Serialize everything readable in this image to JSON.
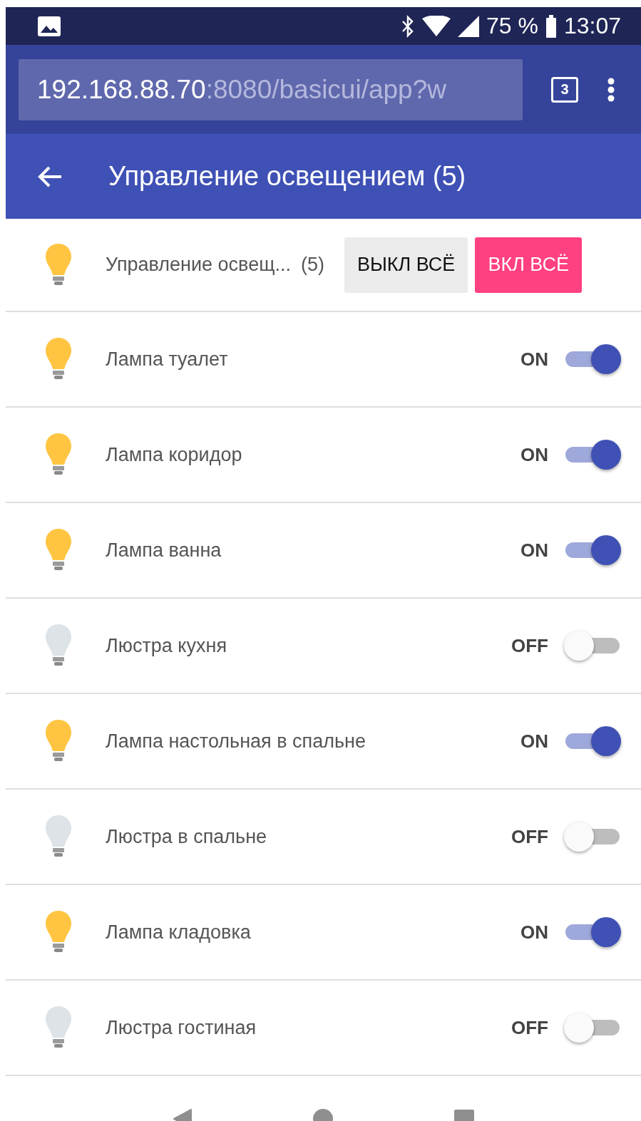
{
  "status_bar": {
    "battery": "75 %",
    "time": "13:07"
  },
  "browser": {
    "url_host": "192.168.88.70",
    "url_rest": ":8080/basicui/app?w",
    "tab_count": "3"
  },
  "app_bar": {
    "title": "Управление освещением (5)"
  },
  "group": {
    "label": "Управление освещ...",
    "count": "(5)",
    "on": true,
    "buttons": [
      {
        "label": "ВЫКЛ ВСЁ",
        "kind": "off"
      },
      {
        "label": "ВКЛ ВСЁ",
        "kind": "on"
      }
    ]
  },
  "items": [
    {
      "label": "Лампа туалет",
      "state": "ON",
      "on": true
    },
    {
      "label": "Лампа коридор",
      "state": "ON",
      "on": true
    },
    {
      "label": "Лампа ванна",
      "state": "ON",
      "on": true
    },
    {
      "label": "Люстра кухня",
      "state": "OFF",
      "on": false
    },
    {
      "label": "Лампа настольная в спальне",
      "state": "ON",
      "on": true
    },
    {
      "label": "Люстра в спальне",
      "state": "OFF",
      "on": false
    },
    {
      "label": "Лампа кладовка",
      "state": "ON",
      "on": true
    },
    {
      "label": "Люстра гостиная",
      "state": "OFF",
      "on": false
    }
  ]
}
